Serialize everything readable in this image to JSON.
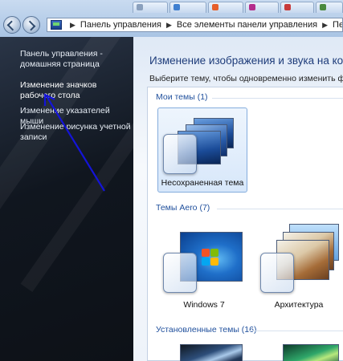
{
  "address_bar": {
    "crumbs": [
      "Панель управления",
      "Все элементы панели управления",
      "Персонали"
    ]
  },
  "left_pane": {
    "links": [
      {
        "label": "Панель управления - домашняя страница"
      },
      {
        "label": "Изменение значков рабочего стола"
      },
      {
        "label": "Изменение указателей мыши"
      },
      {
        "label": "Изменение рисунка учетной записи"
      }
    ]
  },
  "main": {
    "title": "Изменение изображения и звука на ком",
    "subtitle": "Выберите тему, чтобы одновременно изменить фон",
    "groups": {
      "my_themes": "Мои темы (1)",
      "aero_themes": "Темы Aero (7)",
      "installed_themes": "Установленные темы (16)"
    },
    "themes": {
      "unsaved": "Несохраненная тема",
      "windows7": "Windows 7",
      "architecture": "Архитектура"
    }
  },
  "colors": {
    "link_blue": "#1f4f9c",
    "title_blue": "#1e3c7a",
    "arrow_blue": "#1414d8",
    "left_pane_bg": "#10161f"
  },
  "icons": [
    "back-icon",
    "forward-icon",
    "control-panel-icon",
    "chevron-right-icon",
    "windows-logo-icon"
  ]
}
